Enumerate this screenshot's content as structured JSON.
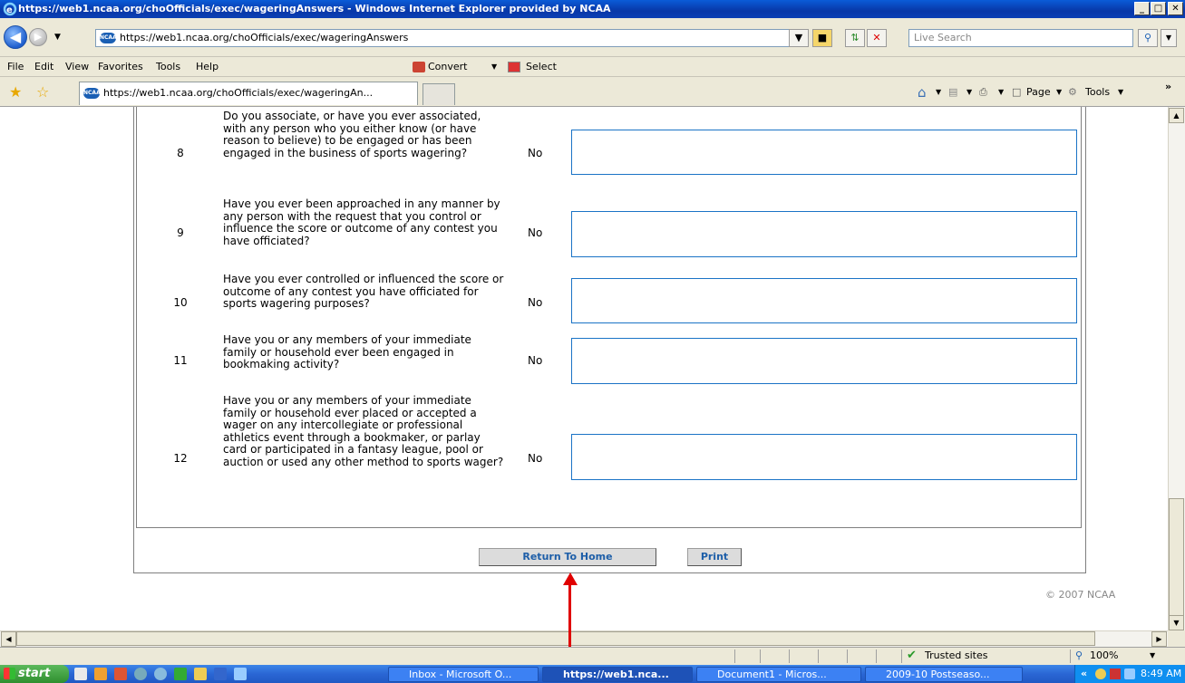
{
  "window": {
    "title": "https://web1.ncaa.org/choOfficials/exec/wageringAnswers - Windows Internet Explorer provided by NCAA",
    "buttons": {
      "minimize": "_",
      "maximize": "□",
      "close": "✕"
    }
  },
  "address": {
    "url": "https://web1.ncaa.org/choOfficials/exec/wageringAnswers",
    "search_placeholder": "Live Search",
    "favicon_text": "NCAA"
  },
  "menu": {
    "items": [
      "File",
      "Edit",
      "View",
      "Favorites",
      "Tools",
      "Help"
    ],
    "convert_label": "Convert",
    "select_label": "Select"
  },
  "tabs": {
    "active_label": "https://web1.ncaa.org/choOfficials/exec/wageringAn...",
    "page_label": "Page",
    "tools_label": "Tools",
    "overflow": "»"
  },
  "questions": [
    {
      "number": "8",
      "text": "Do you associate, or have you ever associated, with any person who you either know (or have reason to believe) to be engaged or has been engaged in the business of sports wagering?",
      "answer": "No"
    },
    {
      "number": "9",
      "text": "Have you ever been approached in any manner by any person with the request that you control or influence the score or outcome of any contest you have officiated?",
      "answer": "No"
    },
    {
      "number": "10",
      "text": "Have you ever controlled or influenced the score or outcome of any contest you have officiated for sports wagering purposes?",
      "answer": "No"
    },
    {
      "number": "11",
      "text": "Have you or any members of your immediate family or household ever been engaged in bookmaking activity?",
      "answer": "No"
    },
    {
      "number": "12",
      "text": "Have you or any members of your immediate family or household ever placed or accepted a wager on any intercollegiate or professional athletics event through a bookmaker, or parlay card or participated in a fantasy league, pool or auction or used any other method to sports wager?",
      "answer": "No"
    }
  ],
  "actions": {
    "return_home": "Return To Home",
    "print": "Print"
  },
  "footer": {
    "copyright": "© 2007 NCAA"
  },
  "status": {
    "zone": "Trusted sites",
    "zoom": "100%"
  },
  "taskbar": {
    "start": "start",
    "items": [
      {
        "label": "Inbox - Microsoft O...",
        "active": false
      },
      {
        "label": "https://web1.nca...",
        "active": true
      },
      {
        "label": "Document1 - Micros...",
        "active": false
      },
      {
        "label": "2009-10 Postseaso...",
        "active": false
      }
    ],
    "clock": "8:49 AM"
  },
  "colors": {
    "link_blue": "#1d5ea8",
    "input_border": "#1a73c6",
    "annotation_red": "#e00000",
    "titlebar": "#0a5bd8"
  }
}
